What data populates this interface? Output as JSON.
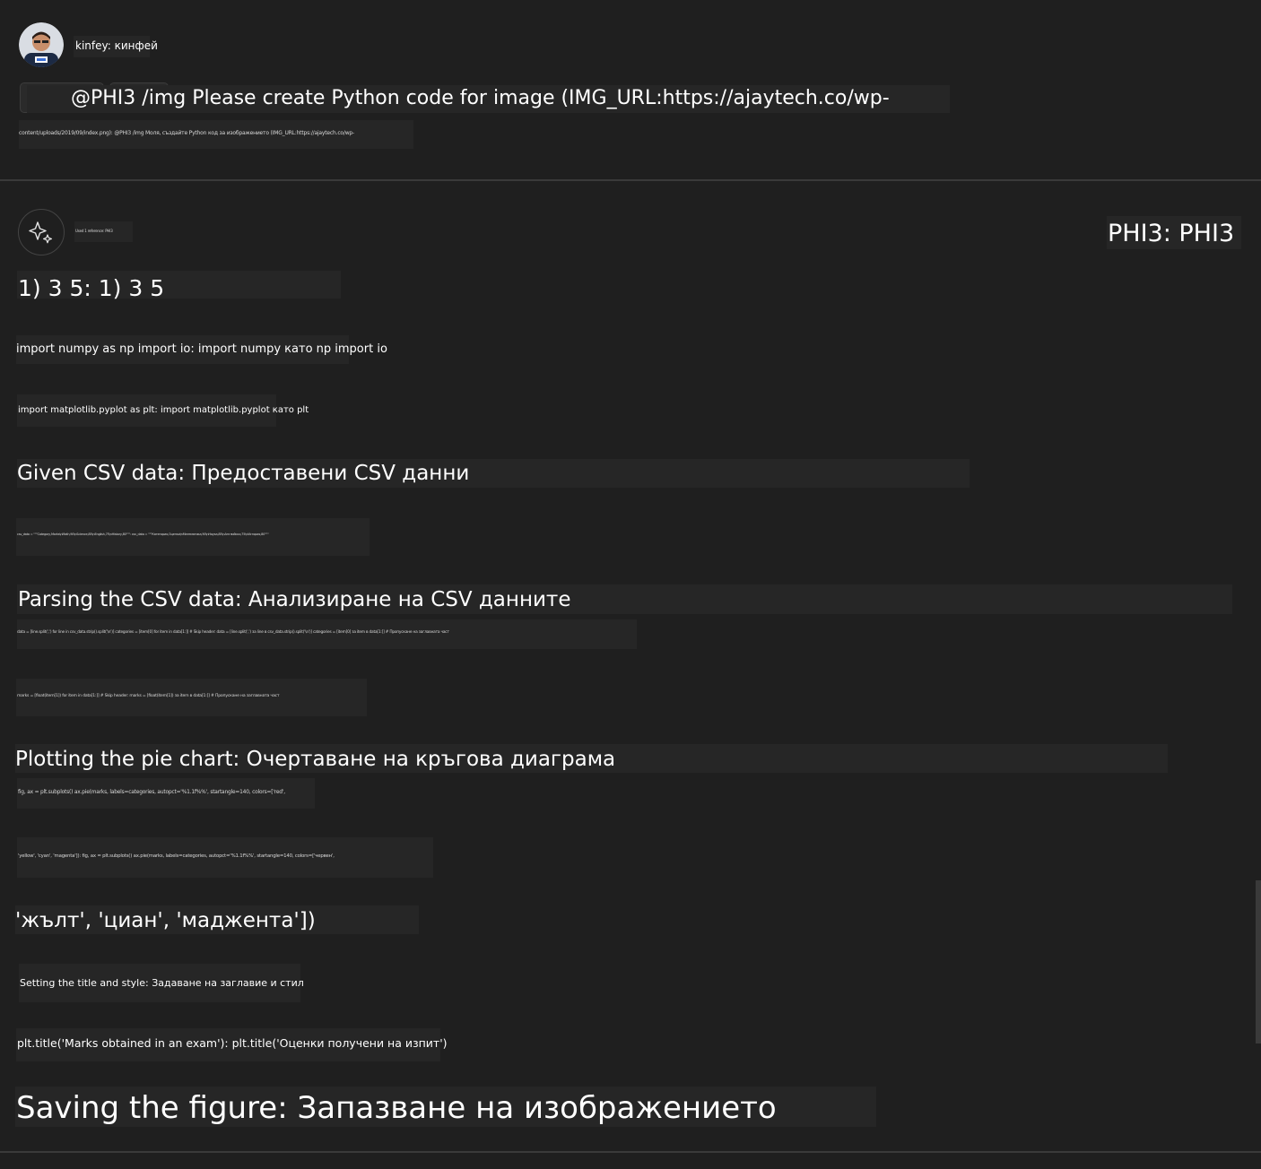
{
  "user": {
    "name_label": "kinfey: кинфей",
    "avatar_icon": "user-avatar-icon",
    "prompt_line1": "@PHI3 /img Please create Python code for image (IMG_URL:https://ajaytech.co/wp-",
    "prompt_line2": "content/uploads/2019/09/index.png): @PHI3 /img Моля, създайте Python код за изображението (IMG_URL:https://ajaytech.co/wp-"
  },
  "assistant": {
    "icon": "sparkle-icon",
    "name_label": "PHI3: PHI3",
    "small_label": "Used 1 reference: PHI3",
    "lines": {
      "step": "1) 3 5: 1) 3 5",
      "import_numpy": "import numpy as np import io: import numpy като np import io",
      "import_plt": "import matplotlib.pyplot as plt: import matplotlib.pyplot като plt",
      "csv_heading": "Given CSV data: Предоставени CSV данни",
      "csv_data": "csv_data = \"\"\"Category,Marks\\nMath,90\\nScience,85\\nEnglish,75\\nHistory,80\"\"\": csv_data = \"\"\"Категория,Оценки\\nМатематика,90\\nНаука,85\\nАнглийски,75\\nИстория,80\"\"\"",
      "parse_heading": "Parsing the CSV data: Анализиране на CSV данните",
      "parse_code1": "data = [line.split(',') for line in csv_data.strip().split('\\n')] categories = [item[0] for item in data[1:]] # Skip header: data = [line.split(',') за line в csv_data.strip().split('\\n')] categories = [item[0] за item в data[1:]] # Пропускане на заглавната част",
      "parse_code2": "marks = [float(item[1]) for item in data[1:]] # Skip header: marks = [float(item[1]) за item в data[1:]] # Пропускане на заглавната част",
      "plot_heading": "Plotting the pie chart: Очертаване на кръгова диаграма",
      "plot_code1": "fig, ax = plt.subplots() ax.pie(marks, labels=categories, autopct='%1.1f%%', startangle=140, colors=['red',",
      "plot_code2": "'yellow', 'cyan', 'magenta']): fig, ax = plt.subplots() ax.pie(marks, labels=categories, autopct='%1.1f%%', startangle=140, colors=['червен',",
      "colors_line": "'жълт', 'циан', 'маджента'])",
      "title_heading": "Setting the title and style: Задаване на заглавие и стил",
      "title_code": "plt.title('Marks obtained in an exam'): plt.title('Оценки получени на изпит')",
      "save_heading": "Saving the figure: Запазване на изображението"
    }
  },
  "colors": {
    "background": "#1f1f1f",
    "band": "#262626",
    "divider": "#3a3a3a",
    "text": "#ffffff"
  }
}
